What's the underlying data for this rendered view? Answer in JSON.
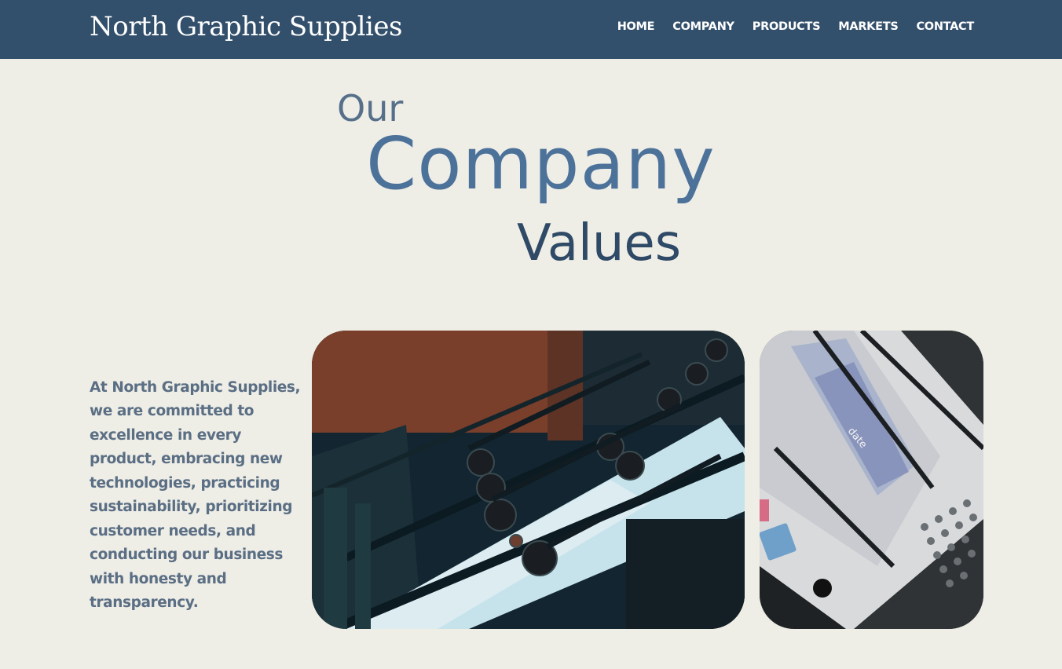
{
  "header": {
    "brand": "North Graphic Supplies",
    "nav": [
      "HOME",
      "COMPANY",
      "PRODUCTS",
      "MARKETS",
      "CONTACT"
    ]
  },
  "hero": {
    "line1": "Our",
    "line2": "Company",
    "line3": "Values"
  },
  "intro": {
    "text": "At North Graphic Supplies, we are committed to excellence in every product, embracing new technologies, practicing sustainability, prioritizing customer needs, and conducting our business with honesty and transparency."
  },
  "images": {
    "printing_press": "printing press rollers photo",
    "printer_interior": "printer interior photo",
    "printer_label": "date"
  },
  "colors": {
    "navbar": "#324f6b",
    "background": "#eeede6",
    "accent": "#4d729a"
  }
}
